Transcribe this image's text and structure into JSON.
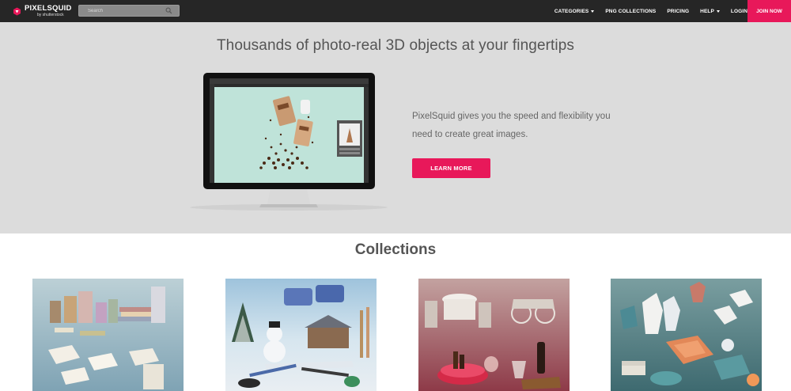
{
  "nav": {
    "logo_name": "PIXELSQUID",
    "logo_sub": "by shutterstock",
    "search_placeholder": "Search",
    "links": [
      {
        "label": "CATEGORIES",
        "dropdown": true
      },
      {
        "label": "PNG COLLECTIONS",
        "dropdown": false
      },
      {
        "label": "PRICING",
        "dropdown": false
      },
      {
        "label": "HELP",
        "dropdown": true
      },
      {
        "label": "LOGIN",
        "dropdown": false
      }
    ],
    "join_label": "JOIN NOW"
  },
  "hero": {
    "title": "Thousands of photo-real 3D objects at your fingertips",
    "description": "PixelSquid gives you the speed and flexibility you need to create great images.",
    "cta_label": "LEARN MORE"
  },
  "collections": {
    "title": "Collections",
    "items": [
      {
        "icon": "shopping-bags-and-books-image"
      },
      {
        "icon": "winter-snowman-image"
      },
      {
        "icon": "valentine-dinner-image"
      },
      {
        "icon": "clothing-image"
      }
    ]
  },
  "colors": {
    "nav_bg": "#262626",
    "accent": "#e8185a",
    "hero_bg": "#dcdcdc"
  }
}
